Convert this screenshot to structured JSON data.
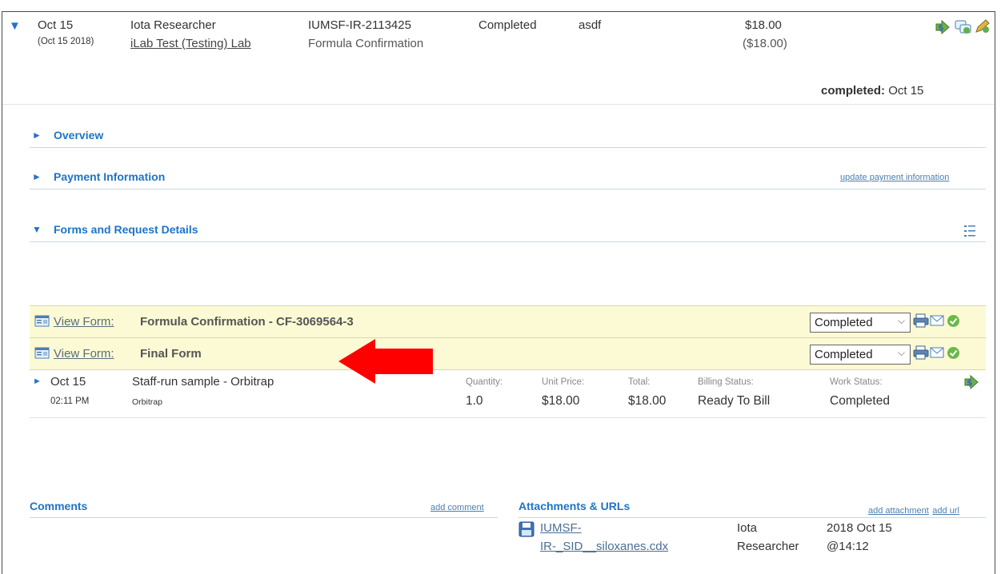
{
  "order": {
    "date": "Oct 15",
    "date_full": "(Oct 15 2018)",
    "researcher": "Iota Researcher",
    "lab": "iLab Test (Testing) Lab",
    "request_id": "IUMSF-IR-2113425",
    "service": "Formula Confirmation",
    "status": "Completed",
    "note": "asdf",
    "price": "$18.00",
    "price_paren": "($18.00)",
    "completed_label": "completed:",
    "completed_date": "Oct 15"
  },
  "sections": {
    "overview": "Overview",
    "payment": "Payment Information",
    "update_payment": "update payment information",
    "forms": "Forms and Request Details"
  },
  "forms": [
    {
      "view_label": "View Form:",
      "title": "Formula Confirmation - CF-3069564-3",
      "status": "Completed"
    },
    {
      "view_label": "View Form:",
      "title": "Final Form",
      "status": "Completed"
    }
  ],
  "charge": {
    "date": "Oct 15",
    "time": "02:11 PM",
    "name": "Staff-run sample - Orbitrap",
    "sub": "Orbitrap",
    "quantity_label": "Quantity:",
    "quantity": "1.0",
    "unit_price_label": "Unit Price:",
    "unit_price": "$18.00",
    "total_label": "Total:",
    "total": "$18.00",
    "billing_label": "Billing Status:",
    "billing": "Ready To Bill",
    "work_label": "Work Status:",
    "work": "Completed"
  },
  "comments": {
    "title": "Comments",
    "add": "add comment"
  },
  "attachments": {
    "title": "Attachments & URLs",
    "add_attachment": "add attachment",
    "add_url": "add url",
    "file_line1": "IUMSF-",
    "file_line2": "IR-_SID__siloxanes.cdx",
    "owner_line1": "Iota",
    "owner_line2": "Researcher",
    "date_line1": "2018 Oct 15",
    "date_line2": "@14:12"
  },
  "colors": {
    "accent": "#1e74c7",
    "form_row_bg": "#fcfad5",
    "arrow": "#ff0000"
  },
  "icons": [
    "expand-caret-icon",
    "dollar-icon",
    "message-icon",
    "edit-icon",
    "form-icon",
    "print-icon",
    "email-icon",
    "check-icon",
    "list-icon",
    "floppy-disk-icon"
  ]
}
